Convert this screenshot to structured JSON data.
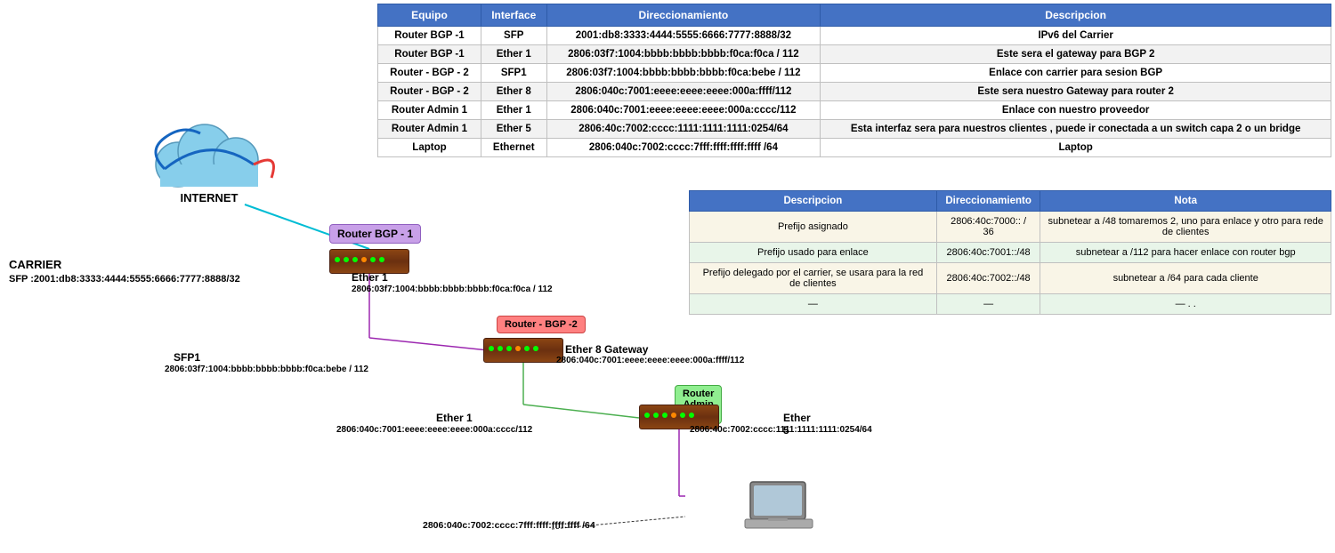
{
  "table": {
    "headers": [
      "Equipo",
      "Interface",
      "Direccionamiento",
      "Descripcion"
    ],
    "rows": [
      {
        "equipo": "Router BGP -1",
        "interface": "SFP",
        "dir": "2001:db8:3333:4444:5555:6666:7777:8888/32",
        "desc": "IPv6 del Carrier"
      },
      {
        "equipo": "Router BGP -1",
        "interface": "Ether 1",
        "dir": "2806:03f7:1004:bbbb:bbbb:bbbb:f0ca:f0ca / 112",
        "desc": "Este sera el gateway para BGP 2"
      },
      {
        "equipo": "Router - BGP - 2",
        "interface": "SFP1",
        "dir": "2806:03f7:1004:bbbb:bbbb:bbbb:f0ca:bebe / 112",
        "desc": "Enlace con carrier para sesion BGP"
      },
      {
        "equipo": "Router - BGP - 2",
        "interface": "Ether 8",
        "dir": "2806:040c:7001:eeee:eeee:eeee:000a:ffff/112",
        "desc": "Este sera nuestro Gateway para router 2"
      },
      {
        "equipo": "Router Admin 1",
        "interface": "Ether 1",
        "dir": "2806:040c:7001:eeee:eeee:eeee:000a:cccc/112",
        "desc": "Enlace con nuestro proveedor"
      },
      {
        "equipo": "Router Admin 1",
        "interface": "Ether 5",
        "dir": "2806:40c:7002:cccc:1111:1111:1111:0254/64",
        "desc": "Esta interfaz sera para nuestros clientes , puede ir conectada a un switch capa 2 o un bridge"
      },
      {
        "equipo": "Laptop",
        "interface": "Ethernet",
        "dir": "2806:040c:7002:cccc:7fff:ffff:ffff:ffff /64",
        "desc": "Laptop"
      }
    ]
  },
  "second_table": {
    "headers": [
      "Descripcion",
      "Direccionamiento",
      "Nota"
    ],
    "rows": [
      {
        "desc": "Prefijo asignado",
        "dir": "2806:40c:7000:: / 36",
        "nota": "subnetear a /48  tomaremos 2, uno para enlace y otro para rede de clientes"
      },
      {
        "desc": "Prefijo usado para enlace",
        "dir": "2806:40c:7001::/48",
        "nota": "subnetear a /112 para hacer enlace con router bgp"
      },
      {
        "desc": "Prefijo delegado por el carrier, se usara para la red de clientes",
        "dir": "2806:40c:7002::/48",
        "nota": "subnetear a /64 para cada cliente"
      },
      {
        "desc": "—",
        "dir": "—",
        "nota": "— . ."
      }
    ]
  },
  "diagram": {
    "internet_label": "INTERNET",
    "carrier_label": "CARRIER",
    "carrier_addr": "SFP :2001:db8:3333:4444:5555:6666:7777:8888/32",
    "router_bgp1": "Router BGP -\n1",
    "router_bgp2": "Router - BGP -2",
    "router_admin1": "Router Admin 1",
    "ether1_label": "Ether 1",
    "ether1_addr": "2806:03f7:1004:bbbb:bbbb:bbbb:f0ca:f0ca / 112",
    "sfp1_label": "SFP1",
    "sfp1_addr": "2806:03f7:1004:bbbb:bbbb:bbbb:f0ca:bebe / 112",
    "ether8_label": "Ether 8 Gateway",
    "ether8_addr": "2806:040c:7001:eeee:eeee:eeee:000a:ffff/112",
    "ether1_admin_label": "Ether 1",
    "ether1_admin_addr": "2806:040c:7001:eeee:eeee:eeee:000a:cccc/112",
    "ether5_label": "Ether 5",
    "ether5_addr": "2806:40c:7002:cccc:1111:1111:1111:0254/64",
    "laptop_addr": "2806:040c:7002:cccc:7fff:ffff:ffff:ffff /64"
  }
}
